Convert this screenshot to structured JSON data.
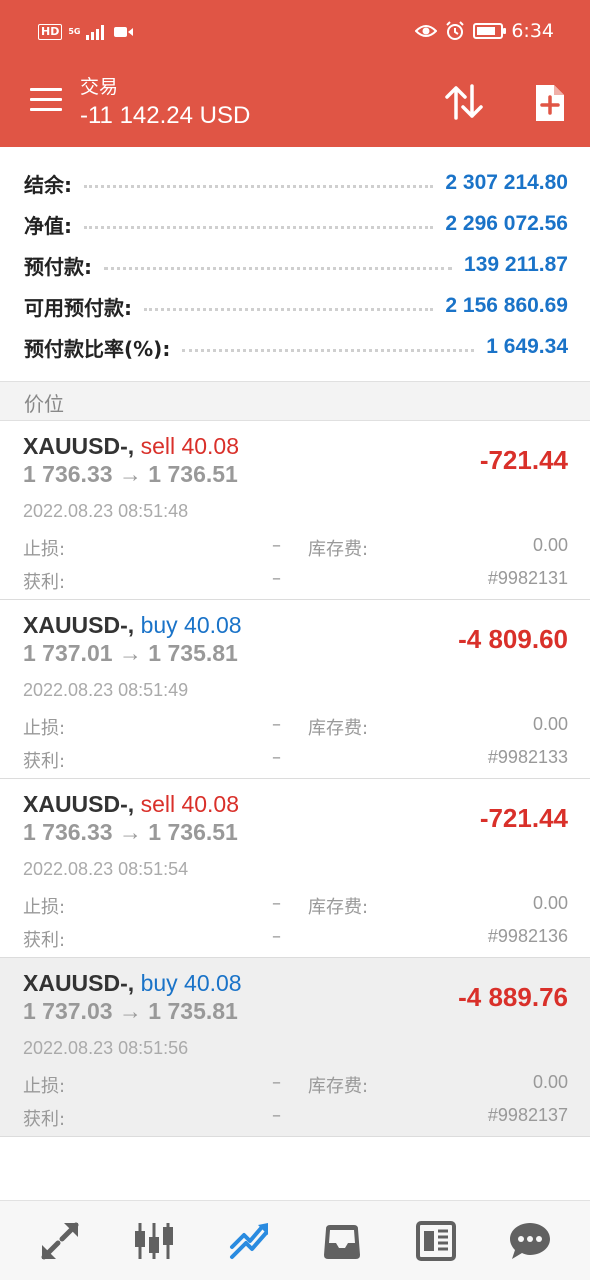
{
  "status_bar": {
    "hd": "HD",
    "net": "5G",
    "time": "6:34",
    "battery_level": 0.8
  },
  "header": {
    "title": "交易",
    "subtitle": "-11 142.24 USD"
  },
  "summary": [
    {
      "label": "结余:",
      "value": "2 307 214.80"
    },
    {
      "label": "净值:",
      "value": "2 296 072.56"
    },
    {
      "label": "预付款:",
      "value": "139 211.87"
    },
    {
      "label": "可用预付款:",
      "value": "2 156 860.69"
    },
    {
      "label": "预付款比率(%):",
      "value": "1 649.34"
    }
  ],
  "section_title": "价位",
  "positions": [
    {
      "symbol": "XAUUSD-,",
      "side": "sell 40.08",
      "prices": "1 736.33 → 1 736.51",
      "profit": "-721.44",
      "time": "2022.08.23 08:51:48",
      "sl_label": "止损:",
      "sl_value": "–",
      "swap_label": "库存费:",
      "swap_value": "0.00",
      "tp_label": "获利:",
      "tp_value": "–",
      "ticket": "#9982131"
    },
    {
      "symbol": "XAUUSD-,",
      "side": "buy 40.08",
      "prices": "1 737.01 → 1 735.81",
      "profit": "-4 809.60",
      "time": "2022.08.23 08:51:49",
      "sl_label": "止损:",
      "sl_value": "–",
      "swap_label": "库存费:",
      "swap_value": "0.00",
      "tp_label": "获利:",
      "tp_value": "–",
      "ticket": "#9982133"
    },
    {
      "symbol": "XAUUSD-,",
      "side": "sell 40.08",
      "prices": "1 736.33 → 1 736.51",
      "profit": "-721.44",
      "time": "2022.08.23 08:51:54",
      "sl_label": "止损:",
      "sl_value": "–",
      "swap_label": "库存费:",
      "swap_value": "0.00",
      "tp_label": "获利:",
      "tp_value": "–",
      "ticket": "#9982136"
    },
    {
      "symbol": "XAUUSD-,",
      "side": "buy 40.08",
      "prices": "1 737.03 → 1 735.81",
      "profit": "-4 889.76",
      "time": "2022.08.23 08:51:56",
      "sl_label": "止损:",
      "sl_value": "–",
      "swap_label": "库存费:",
      "swap_value": "0.00",
      "tp_label": "获利:",
      "tp_value": "–",
      "ticket": "#9982137"
    }
  ],
  "colors": {
    "header": "#e05545",
    "positive": "#1a73c8",
    "negative": "#d9302a",
    "nav_active": "#2a8be0",
    "nav_inactive": "#616161"
  },
  "bottom_nav": [
    {
      "icon": "quotes-icon",
      "active": false
    },
    {
      "icon": "chart-candles-icon",
      "active": false
    },
    {
      "icon": "trade-icon",
      "active": true
    },
    {
      "icon": "history-inbox-icon",
      "active": false
    },
    {
      "icon": "news-icon",
      "active": false
    },
    {
      "icon": "chat-icon",
      "active": false
    }
  ]
}
